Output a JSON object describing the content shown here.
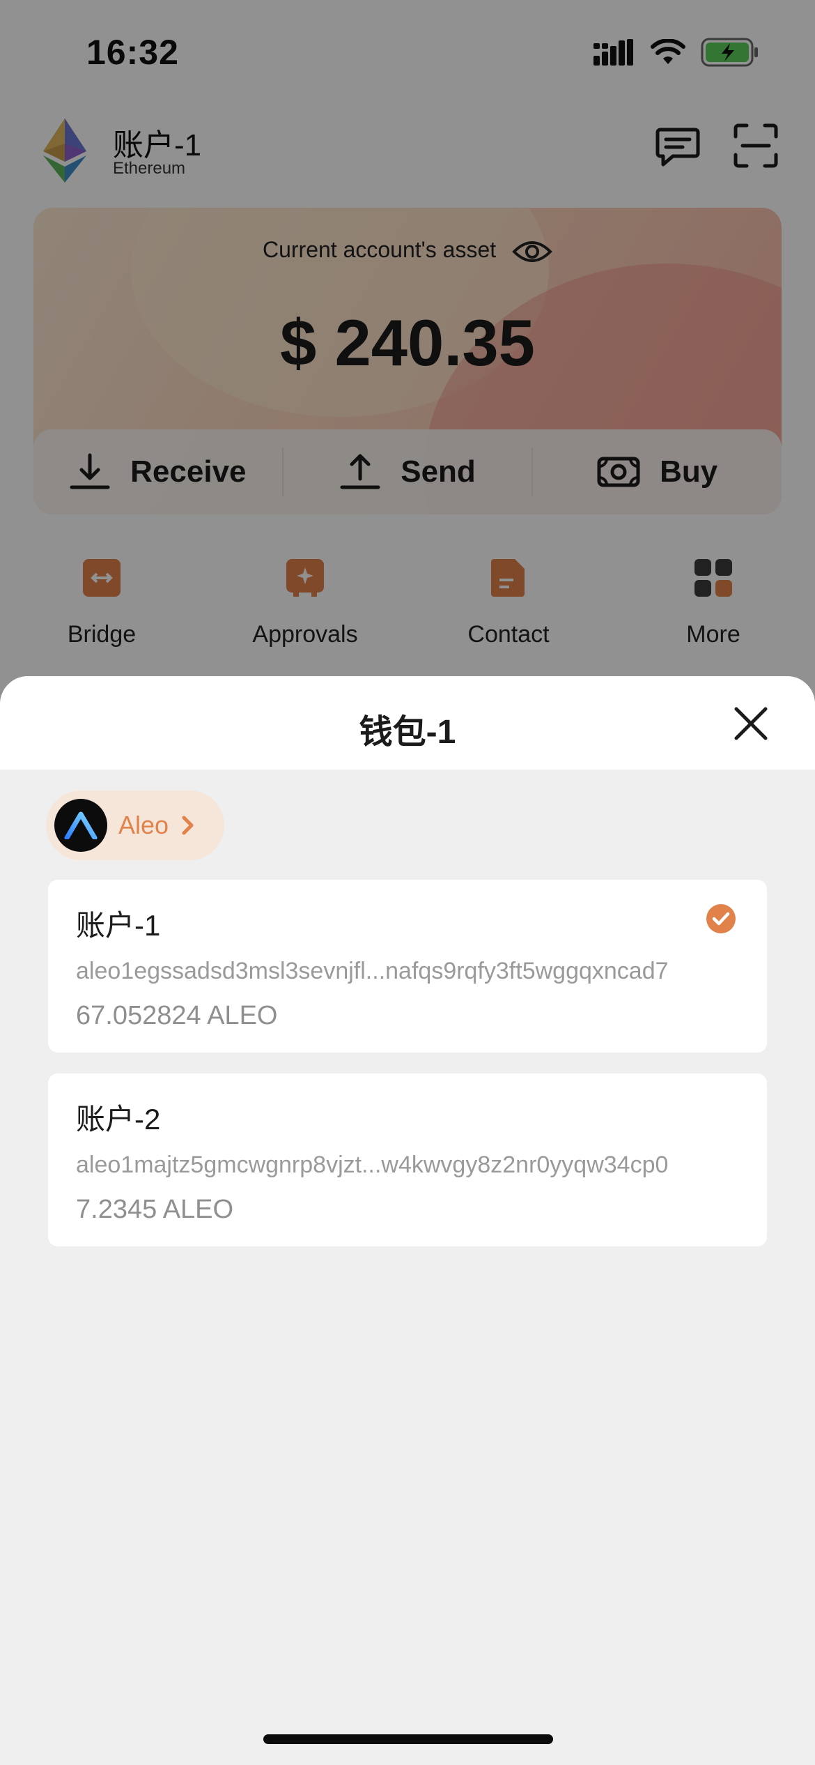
{
  "status_bar": {
    "time": "16:32"
  },
  "header": {
    "account_title": "账户-1",
    "chain": "Ethereum"
  },
  "asset": {
    "label": "Current account's asset",
    "value": "$ 240.35"
  },
  "actions": [
    {
      "label": "Receive",
      "icon": "download-icon"
    },
    {
      "label": "Send",
      "icon": "upload-icon"
    },
    {
      "label": "Buy",
      "icon": "cash-icon"
    }
  ],
  "quick_actions": [
    {
      "label": "Bridge",
      "icon": "bridge-icon"
    },
    {
      "label": "Approvals",
      "icon": "approvals-icon"
    },
    {
      "label": "Contact",
      "icon": "contact-icon"
    },
    {
      "label": "More",
      "icon": "grid-icon"
    }
  ],
  "sheet": {
    "title": "钱包-1",
    "chain_chip": {
      "label": "Aleo"
    },
    "accounts": [
      {
        "name": "账户-1",
        "address": "aleo1egssadsd3msl3sevnjfl...nafqs9rqfy3ft5wggqxncad7",
        "balance": "67.052824 ALEO",
        "selected": true
      },
      {
        "name": "账户-2",
        "address": "aleo1majtz5gmcwgnrp8vjzt...w4kwvgy8z2nr0yyqw34cp0",
        "balance": "7.2345 ALEO",
        "selected": false
      }
    ]
  },
  "colors": {
    "accent": "#e2824b",
    "sheet_bg": "#efefef",
    "dim_overlay": "rgba(0,0,0,0.43)"
  }
}
